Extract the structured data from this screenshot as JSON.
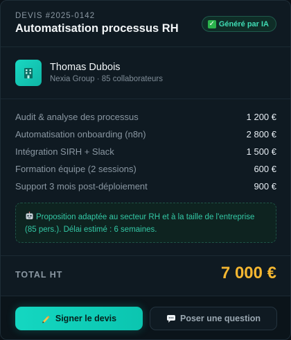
{
  "header": {
    "quote_number": "DEVIS #2025-0142",
    "title": "Automatisation processus RH",
    "badge_check": "✓",
    "badge_label": "Généré par IA"
  },
  "client": {
    "avatar_icon": "building-icon",
    "name": "Thomas Dubois",
    "meta": "Nexia Group · 85 collaborateurs"
  },
  "items": [
    {
      "label": "Audit & analyse des processus",
      "price": "1 200 €"
    },
    {
      "label": "Automatisation onboarding (n8n)",
      "price": "2 800 €"
    },
    {
      "label": "Intégration SIRH + Slack",
      "price": "1 500 €"
    },
    {
      "label": "Formation équipe (2 sessions)",
      "price": "600 €"
    },
    {
      "label": "Support 3 mois post-déploiement",
      "price": "900 €"
    }
  ],
  "note": {
    "icon": "robot-icon",
    "text": "Proposition adaptée au secteur RH et à la taille de l'entreprise (85 pers.). Délai estimé : 6 semaines."
  },
  "total": {
    "label": "TOTAL HT",
    "value": "7 000 €"
  },
  "actions": {
    "sign_label": "Signer le devis",
    "sign_icon": "writing-hand-icon",
    "ask_label": "Poser une question",
    "ask_icon": "speech-bubble-icon"
  },
  "colors": {
    "accent": "#14d7c1",
    "total": "#f5b731",
    "badge_text": "#3fdcb4",
    "background": "#0f1a22"
  }
}
